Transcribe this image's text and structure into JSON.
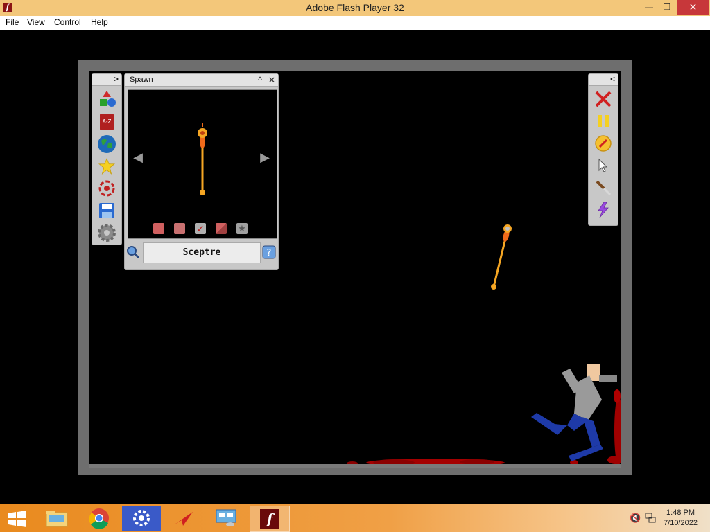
{
  "window": {
    "title": "Adobe Flash Player 32",
    "icon": "flash-player-icon",
    "controls": {
      "minimize": "—",
      "maximize": "❐",
      "close": "✕"
    }
  },
  "menu": {
    "items": [
      "File",
      "View",
      "Control",
      "Help"
    ]
  },
  "left_toolbar": {
    "collapse_glyph": ">",
    "tools": [
      "shapes-icon",
      "a-z-icon",
      "world-icon",
      "star-icon",
      "target-icon",
      "save-icon",
      "gear-icon"
    ],
    "az_text": "A-Z"
  },
  "spawn_panel": {
    "title": "Spawn",
    "collapse_glyph": "^",
    "close_glyph": "✕",
    "prev_glyph": "◀",
    "next_glyph": "▶",
    "selected_item": "Sceptre",
    "chips": [
      "flip-horizontal-icon",
      "swap-icon",
      "check-icon",
      "diagonal-icon",
      "star-badge-icon"
    ]
  },
  "right_toolbar": {
    "collapse_glyph": "<",
    "tools": [
      "delete-icon",
      "pause-icon",
      "compass-icon",
      "pointer-icon",
      "knife-icon",
      "lightning-icon"
    ]
  },
  "taskbar": {
    "apps": [
      "file-explorer-icon",
      "chrome-icon",
      "settings-icon",
      "adobe-app-icon",
      "network-app-icon",
      "flash-player-icon"
    ],
    "tray_icons": [
      "speaker-muted-icon",
      "network-icon"
    ],
    "time": "1:48 PM",
    "date": "7/10/2022"
  },
  "colors": {
    "titlebar": "#f3c77a",
    "taskbar": "#e98a1e",
    "stage_frame": "#6e6e6e",
    "panel": "#c8c8c8",
    "sceptre": "#f5a623",
    "blood": "#a50000"
  }
}
